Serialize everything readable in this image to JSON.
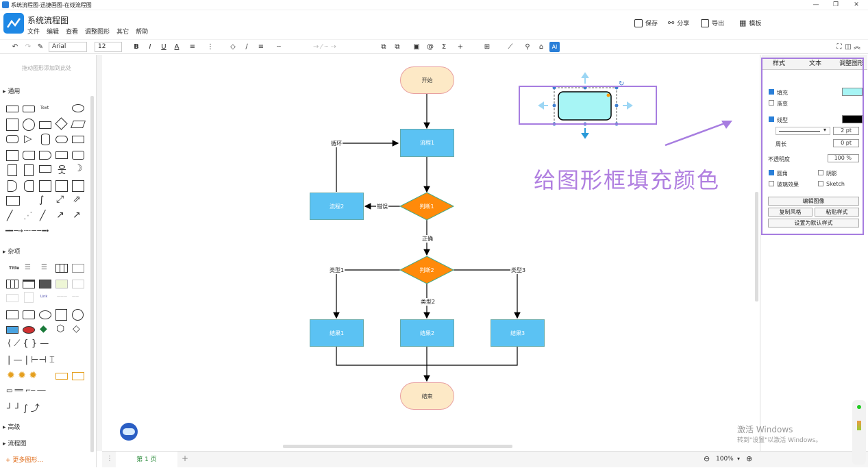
{
  "window": {
    "title": "系统流程图-迅捷画图-在线流程图",
    "controls": [
      "—",
      "❐",
      "✕"
    ]
  },
  "app": {
    "name": "系统流程图"
  },
  "menu": [
    "文件",
    "编辑",
    "查看",
    "调整图形",
    "其它",
    "帮助"
  ],
  "header_actions": {
    "save": "保存",
    "share": "分享",
    "export": "导出",
    "template": "模板"
  },
  "toolbar": {
    "font": "Arial",
    "font_size": "12",
    "bold": "B",
    "italic": "I",
    "underline": "U",
    "color": "A"
  },
  "left_panel": {
    "hint": "拖动图形添加到此处",
    "sections": [
      "通用",
      "杂项",
      "高级",
      "流程图"
    ],
    "more": "+ 更多图形...",
    "text_shape": "Text",
    "title_shape": "Title"
  },
  "flowchart": {
    "start": "开始",
    "process1": "流程1",
    "process2": "流程2",
    "decision1": "判断1",
    "decision2": "判断2",
    "result1": "结果1",
    "result2": "结果2",
    "result3": "结果3",
    "end": "结束",
    "loop": "循环",
    "error": "错误",
    "correct": "正确",
    "type1": "类型1",
    "type2": "类型2",
    "type3": "类型3"
  },
  "caption": "给图形框填充颜色",
  "right_panel": {
    "tabs": [
      "样式",
      "文本",
      "调整图形"
    ],
    "fill": "填充",
    "gradient": "渐变",
    "line": "线型",
    "line_width": "2 pt",
    "perimeter": "周长",
    "perimeter_value": "0 pt",
    "opacity": "不透明度",
    "opacity_value": "100 %",
    "rounded": "圆角",
    "shadow": "阴影",
    "glass": "玻璃效果",
    "sketch": "Sketch",
    "edit_image": "编辑图像",
    "copy_style": "复制风格",
    "paste_style": "粘贴样式",
    "set_default": "设置为默认样式",
    "fill_color": "#a7f5f5",
    "line_color": "#000000"
  },
  "bottom": {
    "page_tab": "第 1 页",
    "zoom": "100%",
    "add": "+"
  },
  "watermark": {
    "line1": "激活 Windows",
    "line2": "转到\"设置\"以激活 Windows。"
  }
}
